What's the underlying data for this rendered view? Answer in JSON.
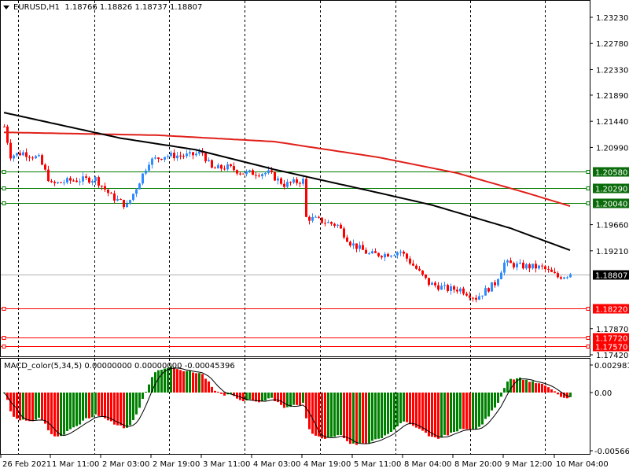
{
  "header": {
    "symbol": "EURUSD,H1",
    "open": "1.18766",
    "high": "1.18826",
    "low": "1.18737",
    "close": "1.18807"
  },
  "macd_header": {
    "name": "MACD_color(5,34,5)",
    "v1": "0.00000000",
    "v2": "0.00000000",
    "v3": "-0.00045396"
  },
  "colors": {
    "bull": "#2f8cff",
    "bear": "#ff0000",
    "ma_slow": "#000000",
    "ma_fast": "#e0201a",
    "support_green": "#007a00",
    "level_red": "#ff0000",
    "macd_up": "#008000",
    "macd_down": "#ff0000"
  },
  "chart_data": [
    {
      "type": "candlestick",
      "title": "EURUSD,H1",
      "ylim": [
        1.1742,
        1.2323
      ],
      "y_ticks": [
        "1.23230",
        "1.22780",
        "1.22330",
        "1.21890",
        "1.21440",
        "1.20990",
        "1.19660",
        "1.19210",
        "1.17870",
        "1.17420"
      ],
      "x_ticks": [
        "26 Feb 2021",
        "1 Mar 11:00",
        "2 Mar 03:00",
        "2 Mar 19:00",
        "3 Mar 11:00",
        "4 Mar 03:00",
        "4 Mar 19:00",
        "5 Mar 11:00",
        "8 Mar 04:00",
        "8 Mar 20:00",
        "9 Mar 12:00",
        "10 Mar 04:00"
      ],
      "bar_count": 181,
      "close_keypoints": [
        [
          0,
          1.2135
        ],
        [
          2,
          1.2085
        ],
        [
          6,
          1.209
        ],
        [
          11,
          1.208
        ],
        [
          15,
          1.2035
        ],
        [
          21,
          1.2042
        ],
        [
          29,
          1.2045
        ],
        [
          34,
          1.2015
        ],
        [
          39,
          1.1998
        ],
        [
          42,
          1.203
        ],
        [
          46,
          1.2075
        ],
        [
          51,
          1.2085
        ],
        [
          59,
          1.2085
        ],
        [
          63,
          1.209
        ],
        [
          66,
          1.2062
        ],
        [
          71,
          1.2065
        ],
        [
          76,
          1.2055
        ],
        [
          84,
          1.2055
        ],
        [
          89,
          1.2035
        ],
        [
          95,
          1.2042
        ],
        [
          96,
          1.1978
        ],
        [
          99,
          1.1975
        ],
        [
          106,
          1.1965
        ],
        [
          110,
          1.1935
        ],
        [
          116,
          1.1915
        ],
        [
          121,
          1.1915
        ],
        [
          126,
          1.192
        ],
        [
          131,
          1.189
        ],
        [
          135,
          1.1865
        ],
        [
          141,
          1.1855
        ],
        [
          145,
          1.1855
        ],
        [
          150,
          1.184
        ],
        [
          156,
          1.1865
        ],
        [
          159,
          1.19
        ],
        [
          164,
          1.1895
        ],
        [
          171,
          1.1892
        ],
        [
          176,
          1.1876
        ],
        [
          180,
          1.18807
        ]
      ],
      "ma_slow_keypoints": [
        [
          0,
          1.2159
        ],
        [
          37,
          1.2115
        ],
        [
          61,
          1.2095
        ],
        [
          86,
          1.2061
        ],
        [
          119,
          1.2021
        ],
        [
          136,
          1.2
        ],
        [
          161,
          1.196
        ],
        [
          180,
          1.1922
        ]
      ],
      "ma_fast_keypoints": [
        [
          0,
          1.2125
        ],
        [
          49,
          1.212
        ],
        [
          86,
          1.2109
        ],
        [
          119,
          1.2082
        ],
        [
          144,
          1.2055
        ],
        [
          166,
          1.2021
        ],
        [
          180,
          1.1998
        ]
      ],
      "levels": [
        {
          "price": 1.2058,
          "label": "1.20580",
          "kind": "green"
        },
        {
          "price": 1.2029,
          "label": "1.20290",
          "kind": "green"
        },
        {
          "price": 1.2004,
          "label": "1.20040",
          "kind": "green"
        },
        {
          "price": 1.18807,
          "label": "1.18807",
          "kind": "current"
        },
        {
          "price": 1.1822,
          "label": "1.18220",
          "kind": "red"
        },
        {
          "price": 1.1772,
          "label": "1.17720",
          "kind": "red"
        },
        {
          "price": 1.1757,
          "label": "1.17570",
          "kind": "red"
        }
      ]
    },
    {
      "type": "bar",
      "title": "MACD_color(5,34,5)",
      "ylim": [
        -0.005664,
        0.0029818
      ],
      "y_ticks": [
        "0.0029818",
        "0.00",
        "-0.005664"
      ]
    }
  ]
}
